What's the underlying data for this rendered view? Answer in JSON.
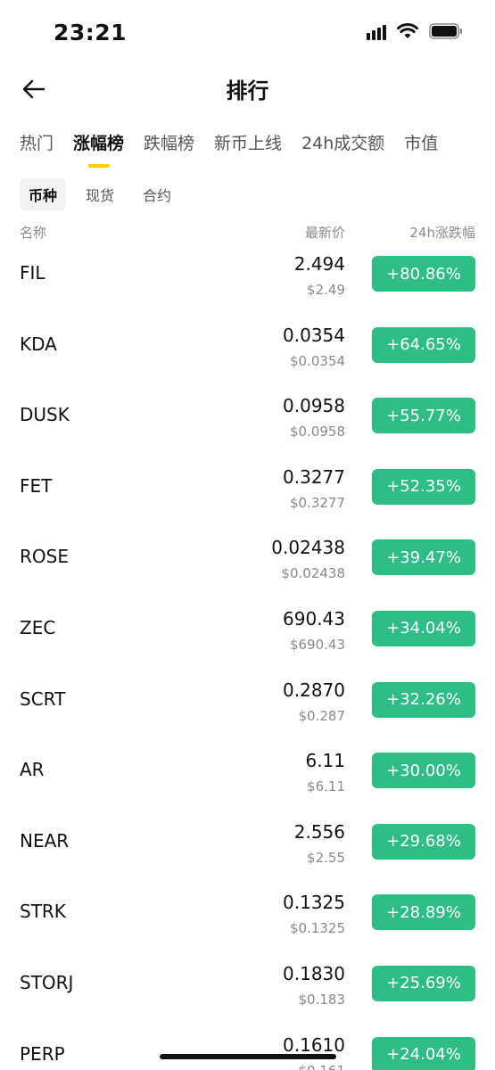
{
  "status_bar": {
    "time": "23:21"
  },
  "header": {
    "title": "排行"
  },
  "tabs": [
    {
      "label": "热门"
    },
    {
      "label": "涨幅榜"
    },
    {
      "label": "跌幅榜"
    },
    {
      "label": "新币上线"
    },
    {
      "label": "24h成交额"
    },
    {
      "label": "市值"
    }
  ],
  "subtabs": [
    {
      "label": "币种"
    },
    {
      "label": "现货"
    },
    {
      "label": "合约"
    }
  ],
  "columns": {
    "name": "名称",
    "price": "最新价",
    "change": "24h涨跌幅"
  },
  "colors": {
    "up": "#2ebd85",
    "tab_indicator": "#f5d000"
  },
  "rows": [
    {
      "symbol": "FIL",
      "price": "2.494",
      "usd": "$2.49",
      "change": "+80.86%"
    },
    {
      "symbol": "KDA",
      "price": "0.0354",
      "usd": "$0.0354",
      "change": "+64.65%"
    },
    {
      "symbol": "DUSK",
      "price": "0.0958",
      "usd": "$0.0958",
      "change": "+55.77%"
    },
    {
      "symbol": "FET",
      "price": "0.3277",
      "usd": "$0.3277",
      "change": "+52.35%"
    },
    {
      "symbol": "ROSE",
      "price": "0.02438",
      "usd": "$0.02438",
      "change": "+39.47%"
    },
    {
      "symbol": "ZEC",
      "price": "690.43",
      "usd": "$690.43",
      "change": "+34.04%"
    },
    {
      "symbol": "SCRT",
      "price": "0.2870",
      "usd": "$0.287",
      "change": "+32.26%"
    },
    {
      "symbol": "AR",
      "price": "6.11",
      "usd": "$6.11",
      "change": "+30.00%"
    },
    {
      "symbol": "NEAR",
      "price": "2.556",
      "usd": "$2.55",
      "change": "+29.68%"
    },
    {
      "symbol": "STRK",
      "price": "0.1325",
      "usd": "$0.1325",
      "change": "+28.89%"
    },
    {
      "symbol": "STORJ",
      "price": "0.1830",
      "usd": "$0.183",
      "change": "+25.69%"
    },
    {
      "symbol": "PERP",
      "price": "0.1610",
      "usd": "$0.161",
      "change": "+24.04%"
    }
  ]
}
